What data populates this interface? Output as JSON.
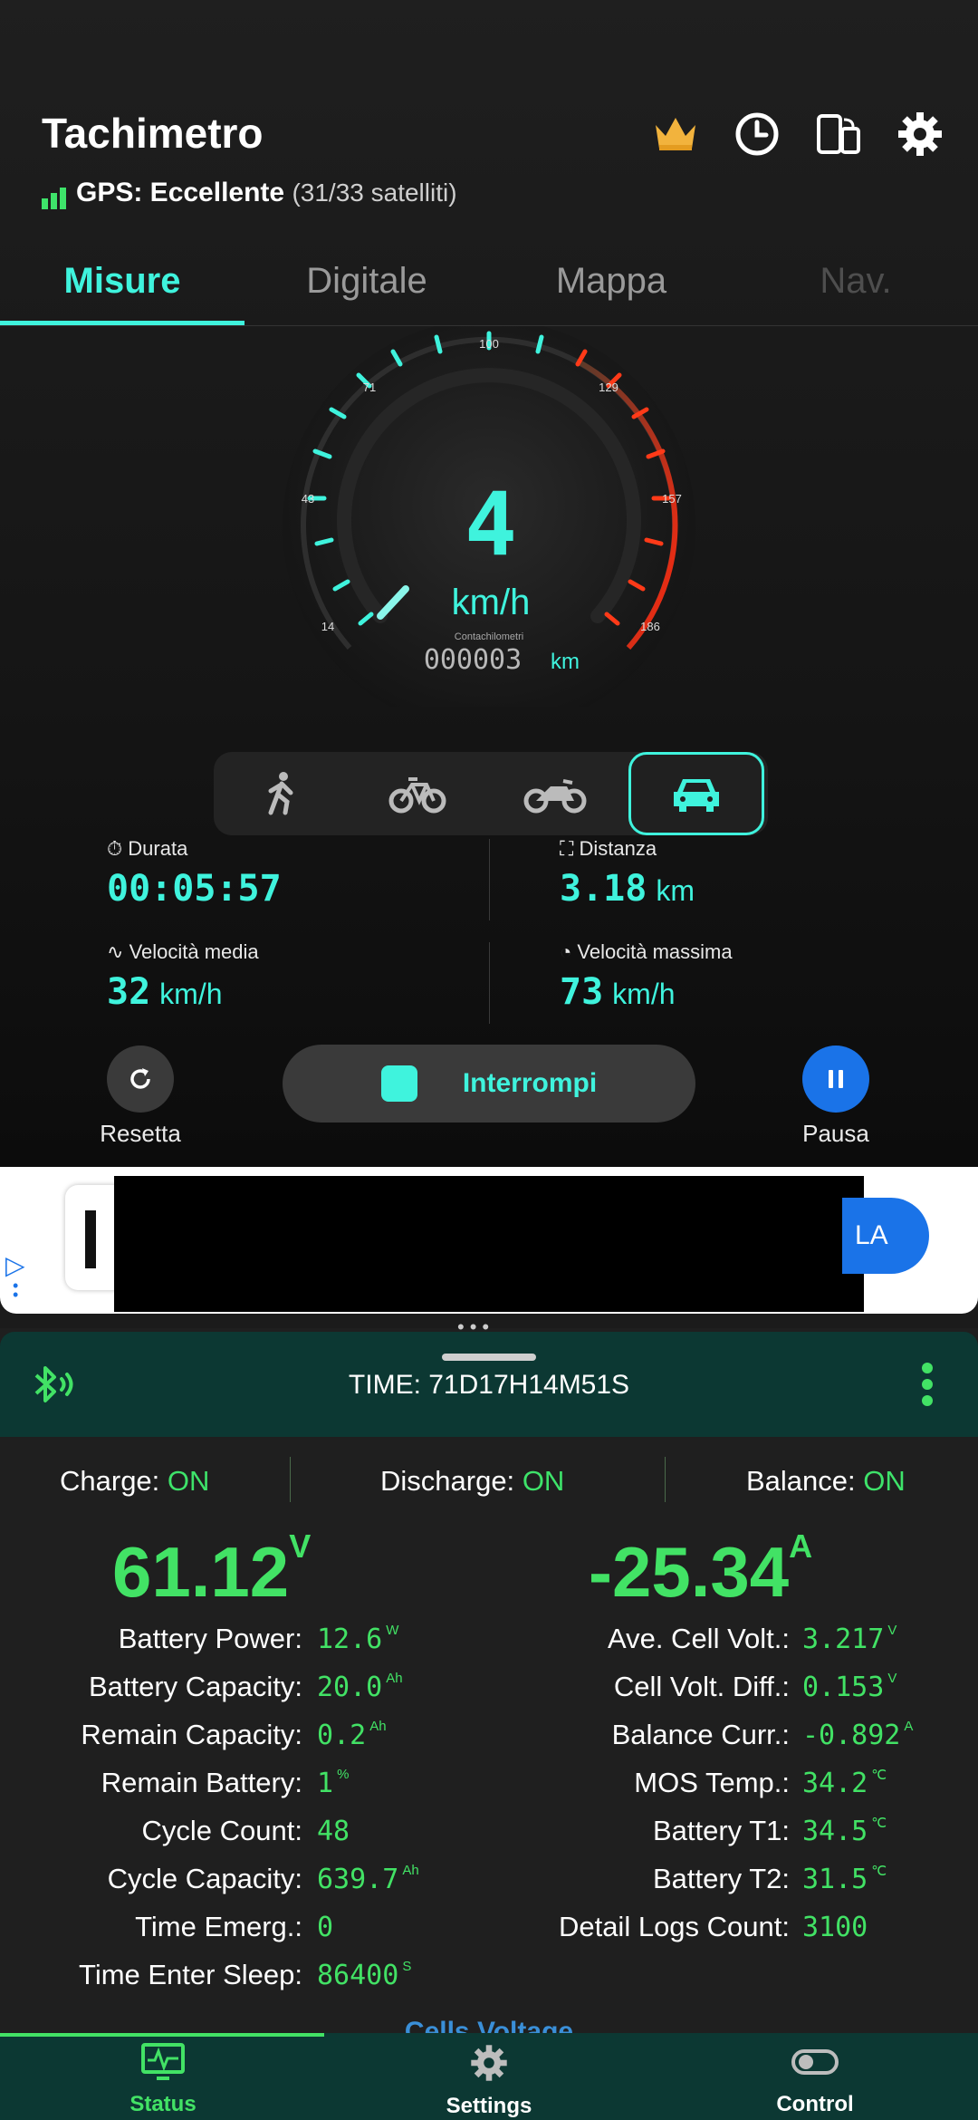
{
  "header": {
    "title": "Tachimetro",
    "gps_label": "GPS: Eccellente",
    "gps_detail": "(31/33 satelliti)"
  },
  "tabs": [
    "Misure",
    "Digitale",
    "Mappa",
    "Nav."
  ],
  "gauge": {
    "ticks": [
      "14",
      "43",
      "71",
      "100",
      "129",
      "157",
      "186"
    ],
    "speed": "4",
    "unit": "km/h",
    "odometer_label": "Contachilometri",
    "odometer_value": "000003",
    "odometer_unit": "km"
  },
  "modes": [
    "walk-icon",
    "bicycle-icon",
    "motorbike-icon",
    "car-icon"
  ],
  "stats": {
    "duration_label": "Durata",
    "duration_value": "00:05:57",
    "distance_label": "Distanza",
    "distance_value": "3.18",
    "distance_unit": "km",
    "avg_label": "Velocità media",
    "avg_value": "32",
    "avg_unit": "km/h",
    "max_label": "Velocità massima",
    "max_value": "73",
    "max_unit": "km/h"
  },
  "controls": {
    "reset_label": "Resetta",
    "stop_label": "Interrompi",
    "pause_label": "Pausa"
  },
  "ad": {
    "button_text": "LA"
  },
  "bms": {
    "time": "TIME: 71D17H14M51S",
    "charge_label": "Charge:",
    "charge_value": "ON",
    "discharge_label": "Discharge:",
    "discharge_value": "ON",
    "balance_label": "Balance:",
    "balance_value": "ON",
    "voltage": "61.12",
    "voltage_unit": "V",
    "current": "-25.34",
    "current_unit": "A",
    "left_rows": [
      {
        "label": "Battery Power:",
        "value": "12.6",
        "unit": "W"
      },
      {
        "label": "Battery Capacity:",
        "value": "20.0",
        "unit": "Ah"
      },
      {
        "label": "Remain Capacity:",
        "value": "0.2",
        "unit": "Ah"
      },
      {
        "label": "Remain Battery:",
        "value": "1",
        "unit": "%"
      },
      {
        "label": "Cycle Count:",
        "value": "48",
        "unit": ""
      },
      {
        "label": "Cycle Capacity:",
        "value": "639.7",
        "unit": "Ah"
      },
      {
        "label": "Time Emerg.:",
        "value": "0",
        "unit": ""
      },
      {
        "label": "Time Enter Sleep:",
        "value": "86400",
        "unit": "S"
      }
    ],
    "right_rows": [
      {
        "label": "Ave. Cell Volt.:",
        "value": "3.217",
        "unit": "V"
      },
      {
        "label": "Cell Volt. Diff.:",
        "value": "0.153",
        "unit": "V"
      },
      {
        "label": "Balance Curr.:",
        "value": "-0.892",
        "unit": "A"
      },
      {
        "label": "MOS Temp.:",
        "value": "34.2",
        "unit": "℃"
      },
      {
        "label": "Battery T1:",
        "value": "34.5",
        "unit": "℃"
      },
      {
        "label": "Battery T2:",
        "value": "31.5",
        "unit": "℃"
      },
      {
        "label": "Detail Logs Count:",
        "value": "3100",
        "unit": ""
      }
    ],
    "cells_title": "Cells Voltage"
  },
  "bottom_nav": [
    {
      "label": "Status",
      "icon": "monitor-icon"
    },
    {
      "label": "Settings",
      "icon": "gear-icon"
    },
    {
      "label": "Control",
      "icon": "toggle-icon"
    }
  ]
}
